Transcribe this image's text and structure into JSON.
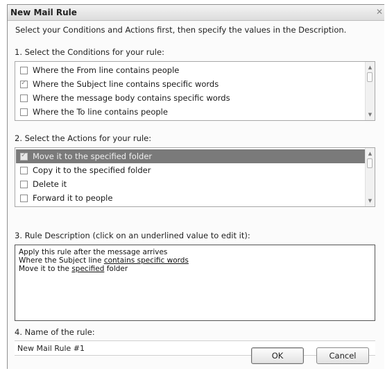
{
  "window": {
    "title": "New Mail Rule"
  },
  "intro": "Select your Conditions and Actions first, then specify the values in the Description.",
  "conditions": {
    "label": "1. Select the Conditions for your rule:",
    "items": [
      {
        "label": "Where the From line contains people",
        "checked": false
      },
      {
        "label": "Where the Subject line contains specific words",
        "checked": true
      },
      {
        "label": "Where the message body contains specific words",
        "checked": false
      },
      {
        "label": "Where the To line contains people",
        "checked": false
      }
    ]
  },
  "actions": {
    "label": "2. Select the Actions for your rule:",
    "items": [
      {
        "label": "Move it to the specified folder",
        "checked": true,
        "selected": true
      },
      {
        "label": "Copy it to the specified folder",
        "checked": false
      },
      {
        "label": "Delete it",
        "checked": false
      },
      {
        "label": "Forward it to people",
        "checked": false
      }
    ]
  },
  "description": {
    "label": "3. Rule Description (click on an underlined value to edit it):",
    "line1": "Apply this rule after the message arrives",
    "line2_prefix": "Where the Subject line ",
    "line2_link": "contains specific words",
    "line3_prefix": "Move it to the ",
    "line3_link": "specified",
    "line3_suffix": " folder"
  },
  "rule_name": {
    "label": "4. Name of the rule:",
    "value": "New Mail Rule #1"
  },
  "buttons": {
    "ok": "OK",
    "cancel": "Cancel"
  },
  "colors": {
    "selection": "#7a7a7a",
    "dialog_bg": "#fbfbfb"
  }
}
